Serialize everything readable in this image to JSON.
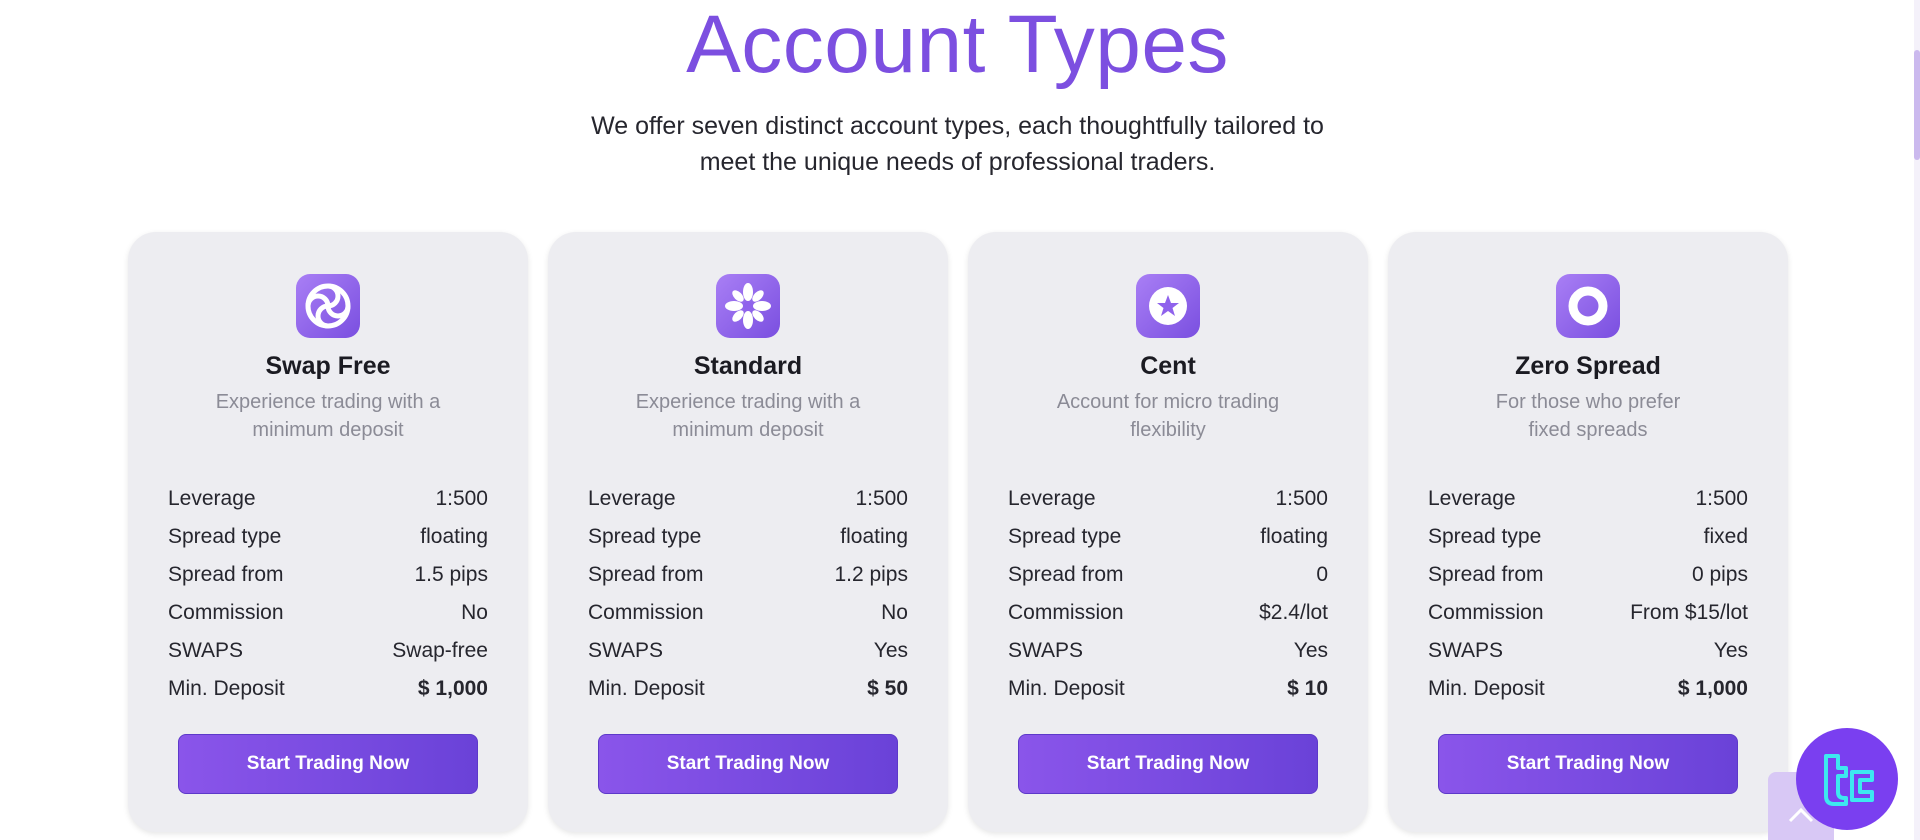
{
  "header": {
    "title": "Account Types",
    "subtitle_line1": "We offer seven distinct account types, each thoughtfully tailored to",
    "subtitle_line2": "meet the unique needs of professional traders."
  },
  "colors": {
    "accent": "#7c4fe0",
    "card_bg": "#ededf1",
    "button": "#7a4be3"
  },
  "cards": [
    {
      "icon": "swirl-icon",
      "name": "Swap Free",
      "desc_line1": "Experience trading with a",
      "desc_line2": "minimum deposit",
      "rows": [
        {
          "label": "Leverage",
          "value": "1:500"
        },
        {
          "label": "Spread type",
          "value": "floating"
        },
        {
          "label": "Spread from",
          "value": "1.5 pips"
        },
        {
          "label": "Commission",
          "value": "No"
        },
        {
          "label": "SWAPS",
          "value": "Swap-free"
        },
        {
          "label": "Min. Deposit",
          "value": "$ 1,000"
        }
      ],
      "button": "Start Trading Now"
    },
    {
      "icon": "flower-icon",
      "name": "Standard",
      "desc_line1": "Experience trading with a",
      "desc_line2": "minimum deposit",
      "rows": [
        {
          "label": "Leverage",
          "value": "1:500"
        },
        {
          "label": "Spread type",
          "value": "floating"
        },
        {
          "label": "Spread from",
          "value": "1.2 pips"
        },
        {
          "label": "Commission",
          "value": "No"
        },
        {
          "label": "SWAPS",
          "value": "Yes"
        },
        {
          "label": "Min. Deposit",
          "value": "$ 50"
        }
      ],
      "button": "Start Trading Now"
    },
    {
      "icon": "star-badge-icon",
      "name": "Cent",
      "desc_line1": "Account for micro trading",
      "desc_line2": "flexibility",
      "rows": [
        {
          "label": "Leverage",
          "value": "1:500"
        },
        {
          "label": "Spread type",
          "value": "floating"
        },
        {
          "label": "Spread from",
          "value": "0"
        },
        {
          "label": "Commission",
          "value": "$2.4/lot"
        },
        {
          "label": "SWAPS",
          "value": "Yes"
        },
        {
          "label": "Min. Deposit",
          "value": "$ 10"
        }
      ],
      "button": "Start Trading Now"
    },
    {
      "icon": "ring-icon",
      "name": "Zero Spread",
      "desc_line1": "For those who prefer",
      "desc_line2": "fixed spreads",
      "rows": [
        {
          "label": "Leverage",
          "value": "1:500"
        },
        {
          "label": "Spread type",
          "value": "fixed"
        },
        {
          "label": "Spread from",
          "value": "0 pips"
        },
        {
          "label": "Commission",
          "value": "From $15/lot"
        },
        {
          "label": "SWAPS",
          "value": "Yes"
        },
        {
          "label": "Min. Deposit",
          "value": "$ 1,000"
        }
      ],
      "button": "Start Trading Now"
    }
  ],
  "widgets": {
    "scroll_top_icon": "chevron-up-icon",
    "badge_icon": "tc-logo-icon"
  }
}
